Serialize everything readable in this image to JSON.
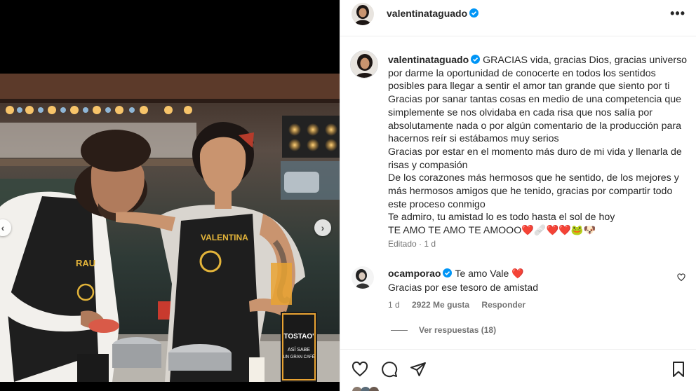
{
  "header": {
    "username": "valentinataguado",
    "more_label": "•••"
  },
  "caption": {
    "username": "valentinataguado",
    "lines": [
      "GRACIAS vida, gracias Dios, gracias universo",
      "por darme la oportunidad de conocerte en todos los sentidos",
      "posibles para llegar a sentir el amor tan grande que siento por ti",
      "Gracias por sanar tantas cosas en medio de una competencia que",
      "simplemente se nos olvidaba en cada risa que nos salía por",
      "absolutamente nada o por algún comentario de la producción para",
      "hacernos reír si estábamos muy serios",
      "Gracias por estar en el momento más duro de mi vida y llenarla de",
      "risas y compasión",
      "De los corazones más hermosos que he sentido, de los mejores y",
      "más hermosos amigos que he tenido, gracias por compartir todo",
      "este proceso conmigo",
      "Te admiro, tu amistad lo es todo hasta el sol de hoy",
      "TE AMO TE AMO TE AMOOO❤️🩹❤️❤️🐸🐶"
    ],
    "edited_label": "Editado",
    "time": "1 d"
  },
  "comment": {
    "username": "ocamporao",
    "text": "Te amo Vale ❤️",
    "line2": "Gracias por ese tesoro de amistad",
    "time": "1 d",
    "likes": "2922 Me gusta",
    "reply_label": "Responder",
    "view_replies": "Ver respuestas (18)"
  },
  "photo": {
    "apron_left": "RAU",
    "apron_right": "VALENTINA",
    "sign_line1": "TOSTAO'",
    "sign_line2": "ASÍ SABE",
    "sign_line3": "UN GRAN CAFÉ"
  },
  "colors": {
    "verified": "#0095f6",
    "text": "#262626",
    "muted": "#737373",
    "border": "#efefef",
    "heart": "#ed4956"
  },
  "icons": {
    "like": "heart-icon",
    "comment": "comment-icon",
    "share": "paper-plane-icon",
    "save": "bookmark-icon"
  }
}
